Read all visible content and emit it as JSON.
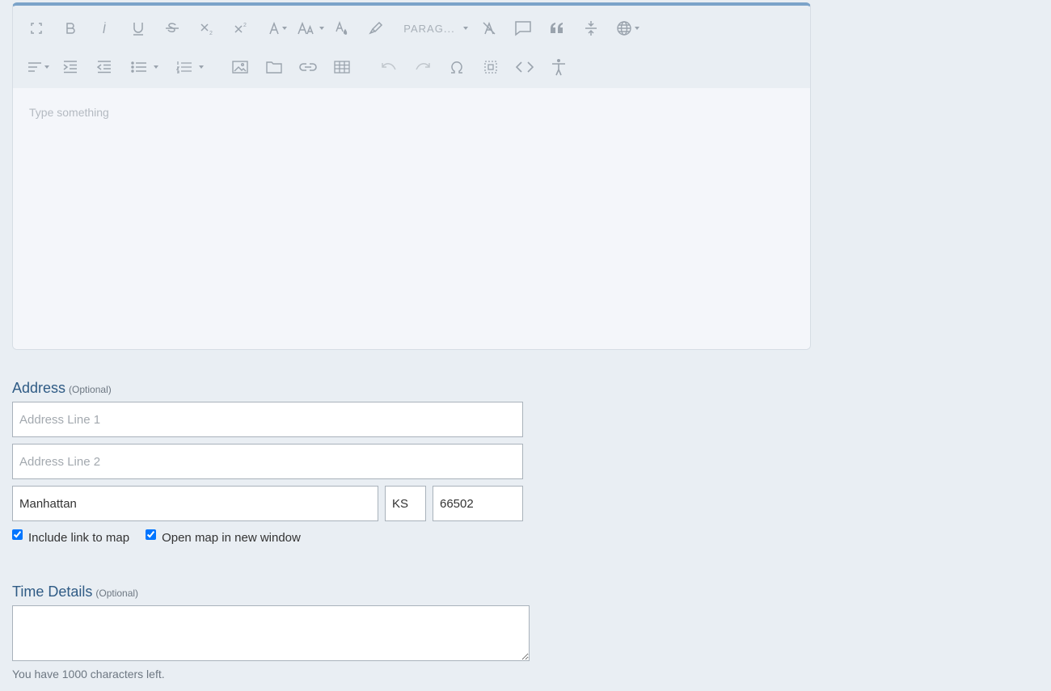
{
  "editor": {
    "placeholder": "Type something",
    "toolbar_row1": [
      "fullscreen-icon",
      "bold-icon",
      "italic-icon",
      "underline-icon",
      "strikethrough-icon",
      "subscript-icon",
      "superscript-icon",
      "font-color-icon",
      "font-size-icon",
      "text-color-drop-icon",
      "highlighter-icon"
    ],
    "paragraph_label": "PARAG...",
    "toolbar_row1_tail": [
      "clear-format-icon",
      "comment-icon",
      "quote-icon",
      "line-height-icon",
      "language-globe-icon"
    ],
    "toolbar_row2": [
      "align-icon",
      "indent-icon",
      "outdent-icon",
      "bullet-list-icon",
      "numbered-list-icon",
      "image-icon",
      "folder-icon",
      "link-icon",
      "table-icon",
      "undo-icon",
      "redo-icon",
      "special-char-icon",
      "select-all-icon",
      "code-view-icon",
      "accessibility-icon"
    ]
  },
  "address": {
    "label": "Address",
    "optional": "(Optional)",
    "line1_placeholder": "Address Line 1",
    "line2_placeholder": "Address Line 2",
    "city": "Manhattan",
    "state": "KS",
    "zip": "66502",
    "include_map_label": "Include link to map",
    "include_map_checked": true,
    "new_window_label": "Open map in new window",
    "new_window_checked": true
  },
  "time_details": {
    "label": "Time Details",
    "optional": "(Optional)",
    "value": "",
    "chars_left": "You have 1000 characters left."
  }
}
